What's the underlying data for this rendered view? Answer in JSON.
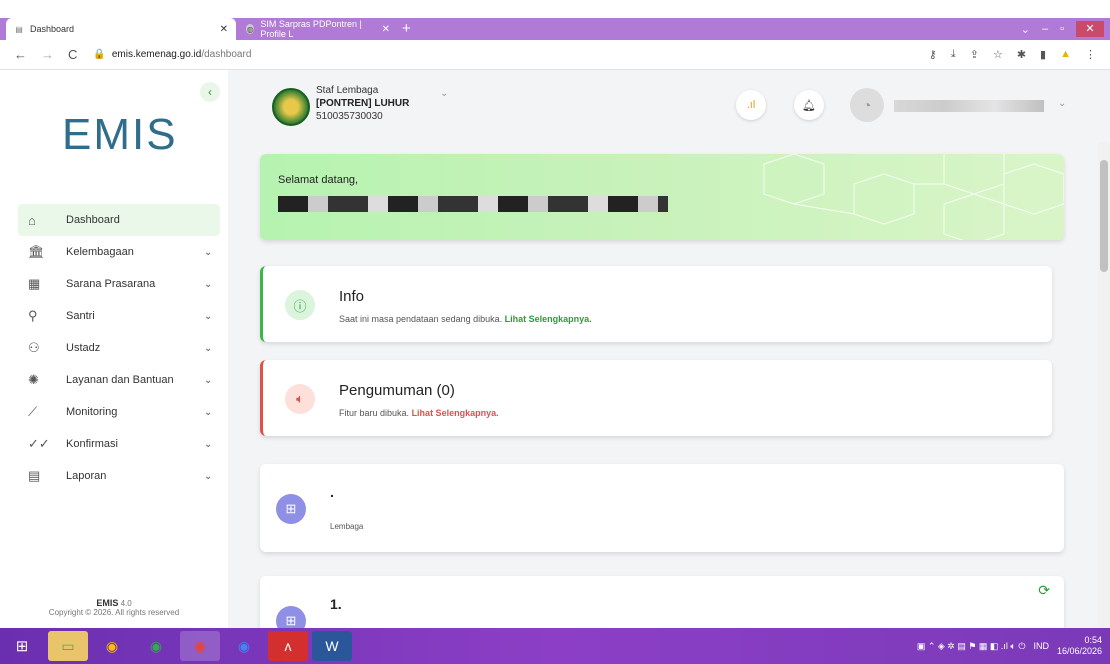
{
  "browser": {
    "tabs": [
      {
        "label": "Dashboard",
        "icon": "page-icon",
        "active": true
      },
      {
        "label": "SIM Sarpras PDPontren | Profile L",
        "icon": "globe-icon",
        "active": false
      }
    ],
    "address": {
      "host": "emis.kemenag.go.id",
      "path": "/dashboard"
    }
  },
  "sidebar": {
    "logo": "EMIS",
    "items": [
      {
        "label": "Dashboard",
        "icon": "home-icon",
        "glyph": "⌂",
        "has_children": false
      },
      {
        "label": "Kelembagaan",
        "icon": "institution-icon",
        "glyph": "🏛",
        "has_children": true
      },
      {
        "label": "Sarana Prasarana",
        "icon": "building-icon",
        "glyph": "▦",
        "has_children": true
      },
      {
        "label": "Santri",
        "icon": "user-icon",
        "glyph": "⚲",
        "has_children": true
      },
      {
        "label": "Ustadz",
        "icon": "users-icon",
        "glyph": "⚇",
        "has_children": true
      },
      {
        "label": "Layanan dan Bantuan",
        "icon": "support-icon",
        "glyph": "✺",
        "has_children": true
      },
      {
        "label": "Monitoring",
        "icon": "chart-line-icon",
        "glyph": "⟋",
        "has_children": true
      },
      {
        "label": "Konfirmasi",
        "icon": "check-double-icon",
        "glyph": "✓✓",
        "has_children": true
      },
      {
        "label": "Laporan",
        "icon": "clipboard-icon",
        "glyph": "▤",
        "has_children": true
      }
    ],
    "footer": {
      "app": "EMIS",
      "version": "4.0",
      "copyright": "Copyright © 2026. All rights reserved"
    }
  },
  "header": {
    "role": "Staf Lembaga",
    "institution": "[PONTREN] LUHUR",
    "code": "510035730030"
  },
  "welcome": {
    "greeting": "Selamat datang,"
  },
  "info": {
    "title": "Info",
    "text": "Saat ini masa pendataan sedang dibuka.",
    "link": "Lihat Selengkapnya."
  },
  "announcement": {
    "title": "Pengumuman (0)",
    "text": "Fitur baru dibuka.",
    "link": "Lihat Selengkapnya."
  },
  "stats": [
    {
      "value": ".",
      "label": "Lembaga"
    },
    {
      "value": "1.",
      "label": ""
    }
  ],
  "taskbar": {
    "lang": "IND",
    "time": "0:54",
    "date": "16/06/2026"
  },
  "colors": {
    "accent": "#2a9d3a",
    "danger": "#e0504a",
    "taskbar": "#7a3ab8"
  }
}
